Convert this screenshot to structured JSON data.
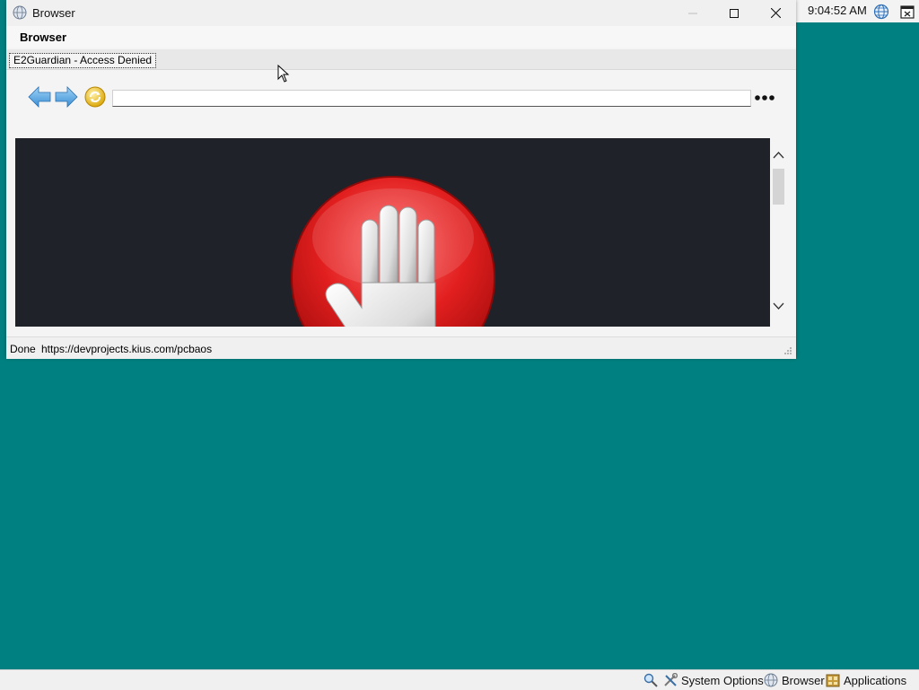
{
  "window": {
    "title": "Browser",
    "app_name": "Browser",
    "tab_label": "E2Guardian - Access Denied"
  },
  "toolbar": {
    "url_value": "",
    "icons": [
      "back-arrow-icon",
      "forward-arrow-icon",
      "reload-icon",
      "more-icon"
    ]
  },
  "content": {
    "graphic": "stop-hand-icon",
    "background": "#1f2229",
    "accent": "#cc1a1a"
  },
  "status": {
    "state": "Done",
    "url": "https://devprojects.kius.com/pcbaos"
  },
  "tray": {
    "clock": "9:04:52 AM"
  },
  "taskbar": {
    "system_options": "System Options",
    "browser": "Browser",
    "applications": "Applications"
  },
  "colors": {
    "desktop": "#008080",
    "window_bg": "#f4f4f4"
  }
}
